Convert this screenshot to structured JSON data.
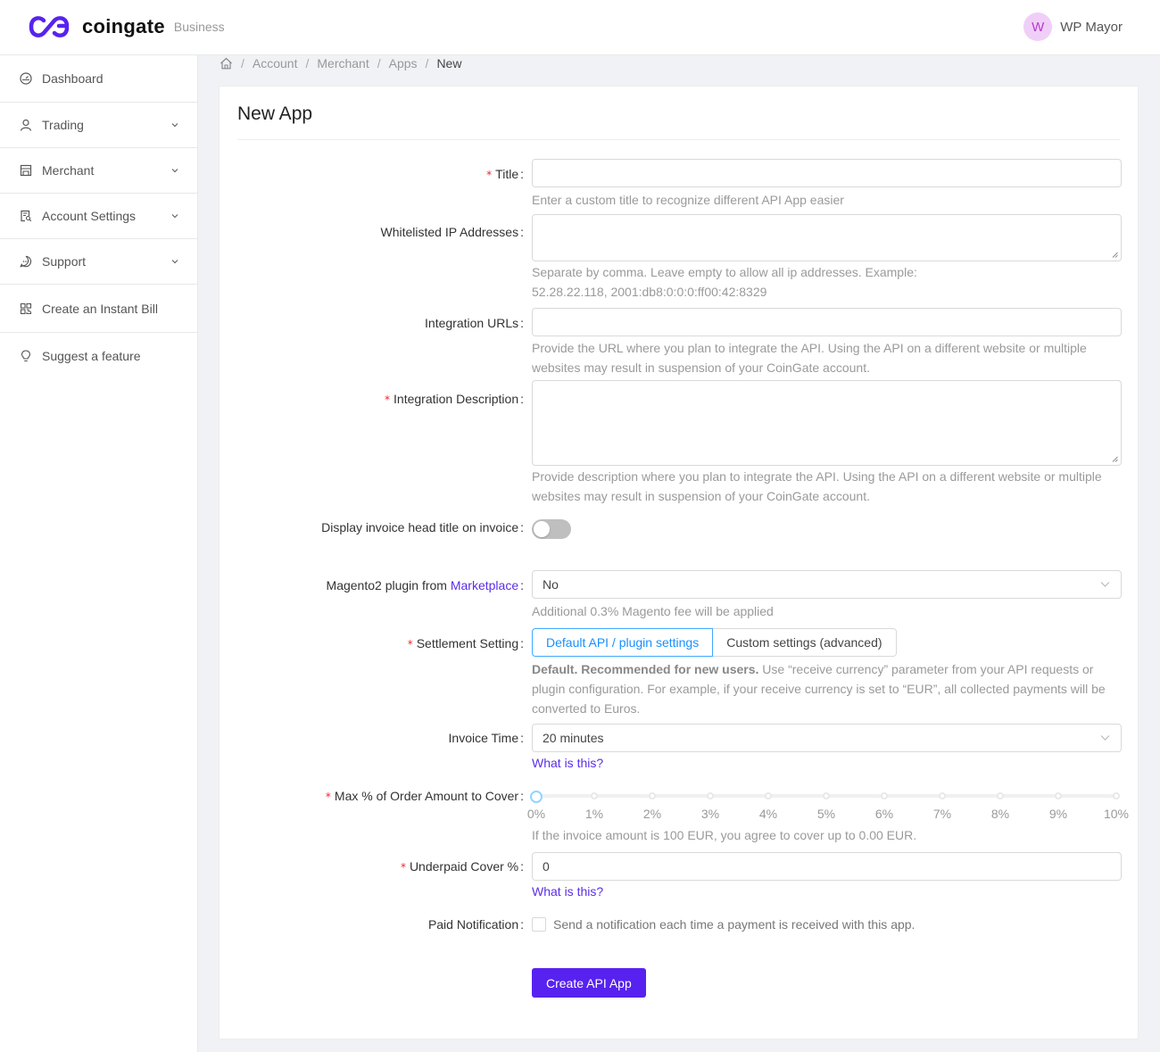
{
  "header": {
    "brand": "coingate",
    "brand_sub": "Business",
    "user_initial": "W",
    "user_name": "WP Mayor"
  },
  "sidebar": {
    "items": [
      {
        "label": "Dashboard",
        "icon": "dashboard-icon",
        "expandable": false
      },
      {
        "label": "Trading",
        "icon": "user-icon",
        "expandable": true
      },
      {
        "label": "Merchant",
        "icon": "shop-icon",
        "expandable": true
      },
      {
        "label": "Account Settings",
        "icon": "profile-icon",
        "expandable": true
      },
      {
        "label": "Support",
        "icon": "message-icon",
        "expandable": true
      },
      {
        "label": "Create an Instant Bill",
        "icon": "qrcode-icon",
        "expandable": false
      },
      {
        "label": "Suggest a feature",
        "icon": "bulb-icon",
        "expandable": false
      }
    ]
  },
  "breadcrumb": {
    "items": [
      "Account",
      "Merchant",
      "Apps"
    ],
    "current": "New"
  },
  "page": {
    "title": "New App"
  },
  "form": {
    "title": {
      "label": "Title",
      "required": true,
      "value": "",
      "help": "Enter a custom title to recognize different API App easier"
    },
    "whitelisted_ips": {
      "label": "Whitelisted IP Addresses",
      "value": "",
      "help": "Separate by comma. Leave empty to allow all ip addresses. Example: 52.28.22.118, 2001:db8:0:0:0:ff00:42:8329"
    },
    "integration_urls": {
      "label": "Integration URLs",
      "value": "",
      "help": "Provide the URL where you plan to integrate the API. Using the API on a different website or multiple websites may result in suspension of your CoinGate account."
    },
    "integration_description": {
      "label": "Integration Description",
      "required": true,
      "value": "",
      "help": "Provide description where you plan to integrate the API. Using the API on a different website or multiple websites may result in suspension of your CoinGate account."
    },
    "display_head_title": {
      "label": "Display invoice head title on invoice",
      "checked": false
    },
    "magento": {
      "label_prefix": "Magento2 plugin from ",
      "label_link": "Marketplace",
      "value": "No",
      "help": "Additional 0.3% Magento fee will be applied"
    },
    "settlement": {
      "label": "Settlement Setting",
      "required": true,
      "options": [
        "Default API / plugin settings",
        "Custom settings (advanced)"
      ],
      "selected": "Default API / plugin settings",
      "help_bold": "Default. Recommended for new users.",
      "help": " Use “receive currency” parameter from your API requests or plugin configuration. For example, if your receive currency is set to “EUR”, all collected payments will be converted to Euros."
    },
    "invoice_time": {
      "label": "Invoice Time",
      "value": "20 minutes",
      "link": "What is this?"
    },
    "max_cover": {
      "label": "Max % of Order Amount to Cover",
      "required": true,
      "value_percent": 0,
      "min": 0,
      "max": 10,
      "marks": [
        "0%",
        "1%",
        "2%",
        "3%",
        "4%",
        "5%",
        "6%",
        "7%",
        "8%",
        "9%",
        "10%"
      ],
      "help": "If the invoice amount is 100 EUR, you agree to cover up to 0.00 EUR."
    },
    "underpaid_cover": {
      "label": "Underpaid Cover %",
      "required": true,
      "value": "0",
      "link": "What is this?"
    },
    "paid_notification": {
      "label": "Paid Notification",
      "checked": false,
      "text": "Send a notification each time a payment is received with this app."
    },
    "submit_label": "Create API App"
  },
  "colors": {
    "brand": "#5722f0",
    "link": "#5b2ee8",
    "required": "#f5222d",
    "active_segment": "#1890ff"
  }
}
